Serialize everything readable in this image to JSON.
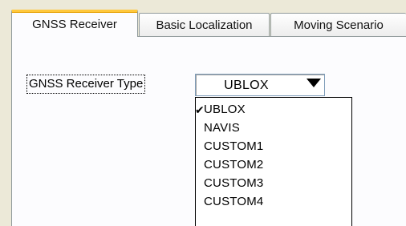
{
  "tabs": [
    {
      "label": "GNSS Receiver",
      "selected": true
    },
    {
      "label": "Basic Localization",
      "selected": false
    },
    {
      "label": "Moving Scenario",
      "selected": false
    }
  ],
  "receiver": {
    "type_label": "GNSS Receiver Type",
    "selected_value": "UBLOX",
    "options": [
      {
        "label": "UBLOX",
        "checked": true,
        "check_glyph": "✔"
      },
      {
        "label": "NAVIS",
        "checked": false,
        "check_glyph": ""
      },
      {
        "label": "CUSTOM1",
        "checked": false,
        "check_glyph": ""
      },
      {
        "label": "CUSTOM2",
        "checked": false,
        "check_glyph": ""
      },
      {
        "label": "CUSTOM3",
        "checked": false,
        "check_glyph": ""
      },
      {
        "label": "CUSTOM4",
        "checked": false,
        "check_glyph": ""
      }
    ]
  },
  "colors": {
    "window_bg": "#ece9d8",
    "panel_bg": "#fcfcfe",
    "tab_highlight": "#ffc83c",
    "tab_border": "#919b9c",
    "combo_border": "#7f9db9"
  },
  "icons": {
    "combo_arrow": "dropdown-arrow-icon",
    "checked_item": "checkmark-icon"
  }
}
